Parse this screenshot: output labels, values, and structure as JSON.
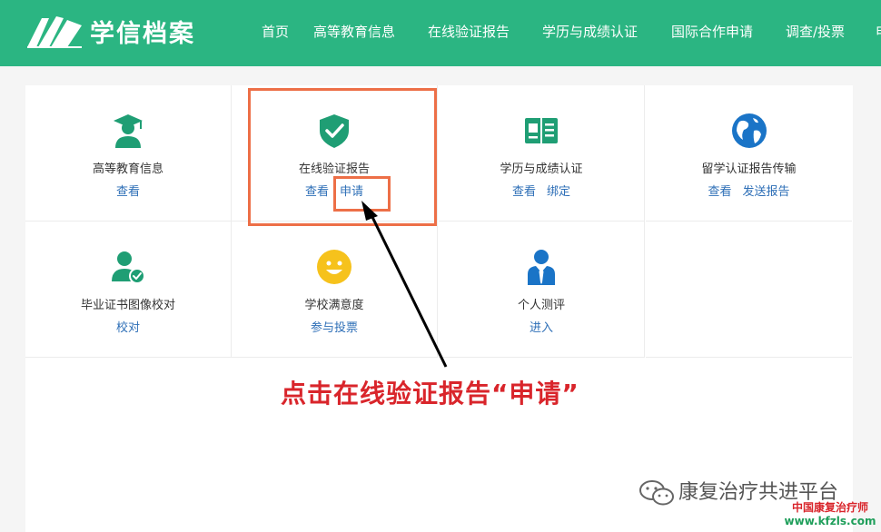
{
  "header": {
    "brand": "学信档案",
    "nav": [
      "首页",
      "高等教育信息",
      "在线验证报告",
      "学历与成绩认证",
      "国际合作申请",
      "调查/投票",
      "申"
    ]
  },
  "colors": {
    "header_bg": "#2bb582",
    "link": "#2e6fb7",
    "highlight": "#ed6f47",
    "instruction": "#d9252b"
  },
  "cards": [
    {
      "title": "高等教育信息",
      "icon": "graduate-icon",
      "links": [
        "查看"
      ]
    },
    {
      "title": "在线验证报告",
      "icon": "shield-check-icon",
      "links": [
        "查看",
        "申请"
      ]
    },
    {
      "title": "学历与成绩认证",
      "icon": "book-icon",
      "links": [
        "查看",
        "绑定"
      ]
    },
    {
      "title": "留学认证报告传输",
      "icon": "globe-icon",
      "links": [
        "查看",
        "发送报告"
      ]
    },
    {
      "title": "毕业证书图像校对",
      "icon": "user-check-icon",
      "links": [
        "校对"
      ]
    },
    {
      "title": "学校满意度",
      "icon": "smiley-icon",
      "links": [
        "参与投票"
      ]
    },
    {
      "title": "个人测评",
      "icon": "person-tie-icon",
      "links": [
        "进入"
      ]
    }
  ],
  "annotation": {
    "instruction": "点击在线验证报告“申请”"
  },
  "watermark": {
    "account": "康复治疗共进平台",
    "site_line1": "中国康复治疗师",
    "site_line2": "www.kfzls.com"
  }
}
